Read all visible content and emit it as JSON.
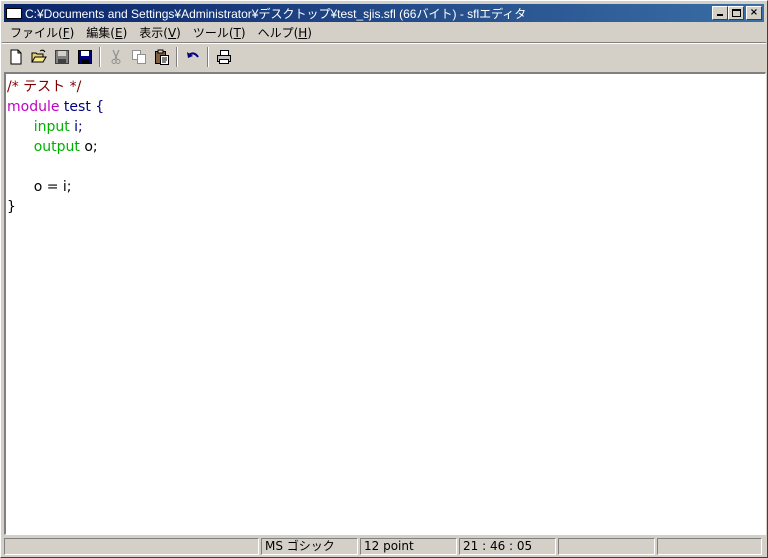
{
  "window": {
    "title": "C:¥Documents and Settings¥Administrator¥デスクトップ¥test_sjis.sfl (66バイト) - sflエディタ",
    "minimize_label": "",
    "maximize_label": "",
    "close_label": "×"
  },
  "menu": {
    "items": [
      {
        "label": "ファイル(",
        "key": "F",
        "tail": ")"
      },
      {
        "label": "編集(",
        "key": "E",
        "tail": ")"
      },
      {
        "label": "表示(",
        "key": "V",
        "tail": ")"
      },
      {
        "label": "ツール(",
        "key": "T",
        "tail": ")"
      },
      {
        "label": "ヘルプ(",
        "key": "H",
        "tail": ")"
      }
    ]
  },
  "toolbar": {
    "buttons": [
      "new-file-icon",
      "open-folder-icon",
      "save-icon",
      "save-all-icon",
      "cut-icon",
      "copy-icon",
      "paste-icon",
      "undo-icon",
      "print-icon"
    ]
  },
  "editor": {
    "lines": [
      [
        {
          "t": "/* テスト */",
          "c": "comment"
        }
      ],
      [
        {
          "t": "module",
          "c": "keyword"
        },
        {
          "t": " ",
          "c": "plain"
        },
        {
          "t": "test",
          "c": "ident"
        },
        {
          "t": " {",
          "c": "ident"
        }
      ],
      [
        {
          "t": "      ",
          "c": "plain"
        },
        {
          "t": "input",
          "c": "io"
        },
        {
          "t": " i;",
          "c": "ident"
        }
      ],
      [
        {
          "t": "      ",
          "c": "plain"
        },
        {
          "t": "output",
          "c": "io"
        },
        {
          "t": " o;",
          "c": "plain"
        }
      ],
      [
        {
          "t": "",
          "c": "plain"
        }
      ],
      [
        {
          "t": "      o = i;",
          "c": "plain"
        }
      ],
      [
        {
          "t": "}",
          "c": "plain"
        }
      ]
    ]
  },
  "status": {
    "pane1": "",
    "font": "MS ゴシック",
    "size": "12 point",
    "time": "21 : 46 : 05",
    "pane5": "",
    "pane6": ""
  },
  "colors": {
    "titlebar": "#0a246a",
    "comment": "#800000",
    "keyword": "#c000c0",
    "io": "#00b000",
    "ident": "#000080"
  }
}
